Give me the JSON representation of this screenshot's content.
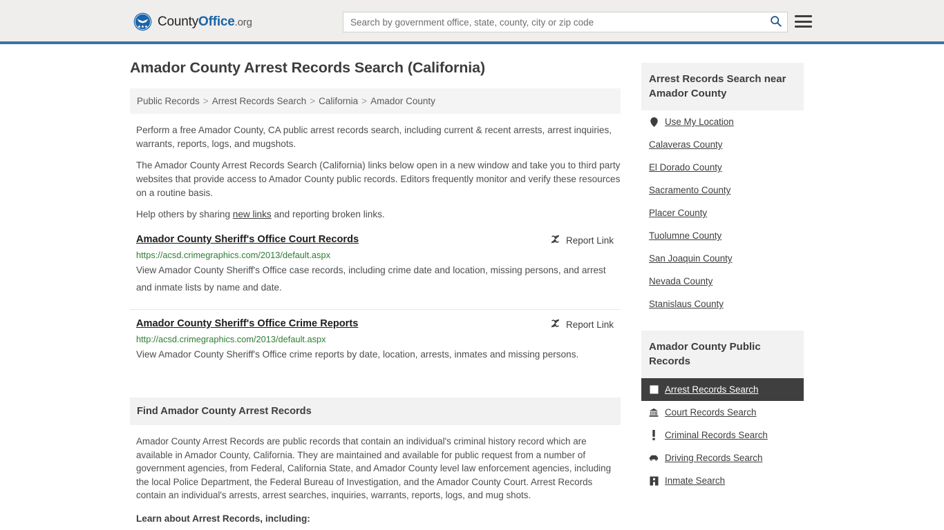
{
  "header": {
    "brand": {
      "part1": "County",
      "part2": "Office",
      "part3": ".org",
      "logo_icon": "eagle-seal-icon"
    },
    "search": {
      "placeholder": "Search by government office, state, county, city or zip code",
      "value": ""
    },
    "search_icon": "search-icon",
    "menu_icon": "hamburger-menu-icon"
  },
  "main": {
    "title": "Amador County Arrest Records Search (California)",
    "breadcrumb": [
      {
        "label": "Public Records"
      },
      {
        "label": "Arrest Records Search"
      },
      {
        "label": "California"
      },
      {
        "label": "Amador County"
      }
    ],
    "breadcrumb_separator": ">",
    "intro": {
      "p1": "Perform a free Amador County, CA public arrest records search, including current & recent arrests, arrest inquiries, warrants, reports, logs, and mugshots.",
      "p2": "The Amador County Arrest Records Search (California) links below open in a new window and take you to third party websites that provide access to Amador County public records. Editors frequently monitor and verify these resources on a routine basis.",
      "p3_before": "Help others by sharing ",
      "p3_link": "new links",
      "p3_after": " and reporting broken links."
    },
    "report_link_label": "Report Link",
    "report_link_icon": "broken-link-icon",
    "results": [
      {
        "title": "Amador County Sheriff's Office Court Records",
        "url": "https://acsd.crimegraphics.com/2013/default.aspx",
        "description": "View Amador County Sheriff's Office case records, including crime date and location, missing persons, and arrest and inmate lists by name and date."
      },
      {
        "title": "Amador County Sheriff's Office Crime Reports",
        "url": "http://acsd.crimegraphics.com/2013/default.aspx",
        "description": "View Amador County Sheriff's Office crime reports by date, location, arrests, inmates and missing persons."
      }
    ],
    "section": {
      "heading": "Find Amador County Arrest Records",
      "body": "Amador County Arrest Records are public records that contain an individual's criminal history record which are available in Amador County, California. They are maintained and available for public request from a number of government agencies, from Federal, California State, and Amador County level law enforcement agencies, including the local Police Department, the Federal Bureau of Investigation, and the Amador County Court. Arrest Records contain an individual's arrests, arrest searches, inquiries, warrants, reports, logs, and mug shots.",
      "sub_heading": "Learn about Arrest Records, including:"
    }
  },
  "sidebar": {
    "nearby": {
      "heading": "Arrest Records Search near Amador County",
      "use_my_location": {
        "label": "Use My Location",
        "icon": "map-pin-icon"
      },
      "counties": [
        {
          "label": "Calaveras County"
        },
        {
          "label": "El Dorado County"
        },
        {
          "label": "Sacramento County"
        },
        {
          "label": "Placer County"
        },
        {
          "label": "Tuolumne County"
        },
        {
          "label": "San Joaquin County"
        },
        {
          "label": "Nevada County"
        },
        {
          "label": "Stanislaus County"
        }
      ]
    },
    "public_records": {
      "heading": "Amador County Public Records",
      "items": [
        {
          "label": "Arrest Records Search",
          "icon": "white-square-icon",
          "active": true
        },
        {
          "label": "Court Records Search",
          "icon": "courthouse-icon",
          "active": false
        },
        {
          "label": "Criminal Records Search",
          "icon": "exclamation-icon",
          "active": false
        },
        {
          "label": "Driving Records Search",
          "icon": "car-icon",
          "active": false
        },
        {
          "label": "Inmate Search",
          "icon": "building-icon",
          "active": false
        }
      ]
    }
  },
  "colors": {
    "accent_blue": "#3a72a8",
    "link_green": "#2e7d32",
    "active_bg": "#3f3f3f",
    "panel_gray": "#f2f2f2"
  }
}
